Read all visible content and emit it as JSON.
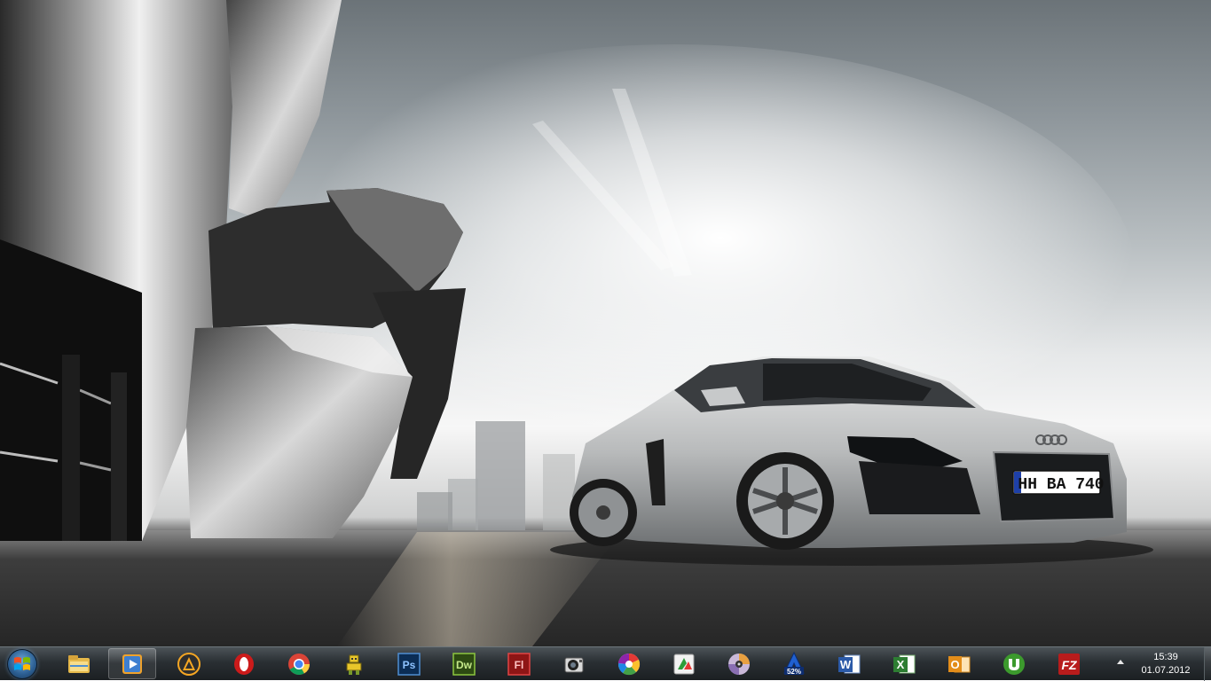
{
  "wallpaper": {
    "plate": "HH BA 740"
  },
  "taskbar": {
    "start_icon": "windows-orb-icon",
    "buttons": [
      {
        "icon": "windows-explorer-icon",
        "active": false
      },
      {
        "icon": "media-player-icon",
        "active": true
      },
      {
        "icon": "aimp-player-icon",
        "active": false
      },
      {
        "icon": "opera-browser-icon",
        "active": false
      },
      {
        "icon": "chrome-browser-icon",
        "active": false
      },
      {
        "icon": "robot-app-icon",
        "active": false
      },
      {
        "icon": "photoshop-icon",
        "active": false
      },
      {
        "icon": "dreamweaver-icon",
        "active": false
      },
      {
        "icon": "flash-icon",
        "active": false
      },
      {
        "icon": "webcam-icon",
        "active": false
      },
      {
        "icon": "picasa-icon",
        "active": false
      },
      {
        "icon": "download-manager-icon",
        "active": false
      },
      {
        "icon": "disc-burner-icon",
        "active": false
      },
      {
        "icon": "update-app-icon",
        "active": false
      },
      {
        "icon": "word-icon",
        "active": false
      },
      {
        "icon": "excel-icon",
        "active": false
      },
      {
        "icon": "outlook-icon",
        "active": false
      },
      {
        "icon": "utorrent-icon",
        "active": false
      },
      {
        "icon": "filezilla-icon",
        "active": false
      }
    ],
    "labels": {
      "photoshop": "Ps",
      "dreamweaver": "Dw",
      "flash": "Fl",
      "update_percent": "52%",
      "word": "W",
      "excel": "X",
      "outlook": "O",
      "filezilla": "FZ"
    },
    "clock": {
      "time": "15:39",
      "date": "01.07.2012"
    }
  },
  "colors": {
    "taskbar_top": "#4c5358",
    "taskbar_bottom": "#1b1f22",
    "photoshop": "#1c4f8a",
    "dreamweaver": "#3f6b1c",
    "flash": "#a81d1d",
    "word": "#2b5aa8",
    "excel": "#2d7d32",
    "outlook": "#e38d1a",
    "utorrent": "#3c9a2d",
    "filezilla": "#b81c1c",
    "opera": "#cc1b1b"
  }
}
